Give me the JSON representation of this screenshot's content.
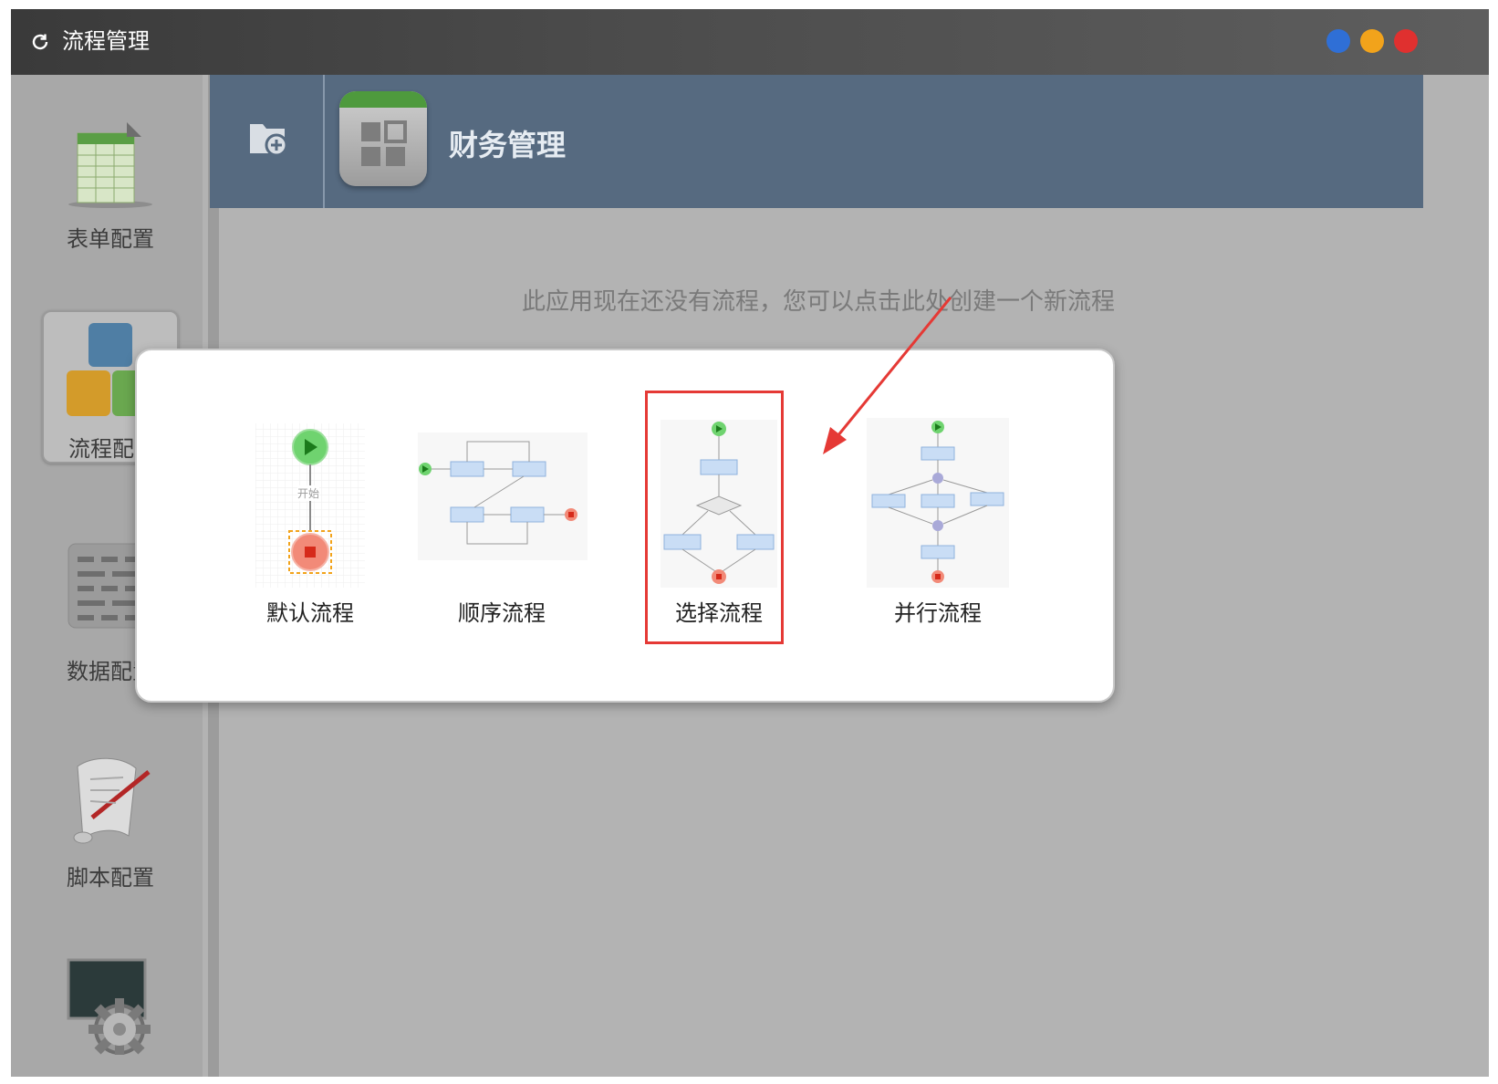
{
  "window": {
    "title": "流程管理",
    "controls": [
      {
        "name": "blue",
        "color": "#2f6fd6"
      },
      {
        "name": "orange",
        "color": "#f2a31b"
      },
      {
        "name": "red",
        "color": "#e0302f"
      }
    ]
  },
  "sidebar": {
    "items": [
      {
        "label": "表单配置",
        "icon": "form-sheet-icon",
        "active": false
      },
      {
        "label": "流程配置",
        "icon": "blocks-icon",
        "active": true
      },
      {
        "label": "数据配置",
        "icon": "data-grid-icon",
        "active": false
      },
      {
        "label": "脚本配置",
        "icon": "script-scroll-icon",
        "active": false
      },
      {
        "label": "",
        "icon": "settings-gear-icon",
        "active": false
      }
    ]
  },
  "header": {
    "add_icon": "folder-add-icon",
    "app_icon": "app-grid-icon",
    "app_name": "财务管理"
  },
  "hint": "此应用现在还没有流程，您可以点击此处创建一个新流程",
  "modal": {
    "options": [
      {
        "label": "默认流程",
        "thumb_text": "开始"
      },
      {
        "label": "顺序流程",
        "thumb_text": ""
      },
      {
        "label": "选择流程",
        "thumb_text": ""
      },
      {
        "label": "并行流程",
        "thumb_text": ""
      }
    ],
    "selected": "选择流程"
  },
  "colors": {
    "header": "#566a80",
    "highlight": "#e53935",
    "start_node": "#6fd36f",
    "end_node": "#f28a78",
    "task_box": "#c9ddf5"
  }
}
